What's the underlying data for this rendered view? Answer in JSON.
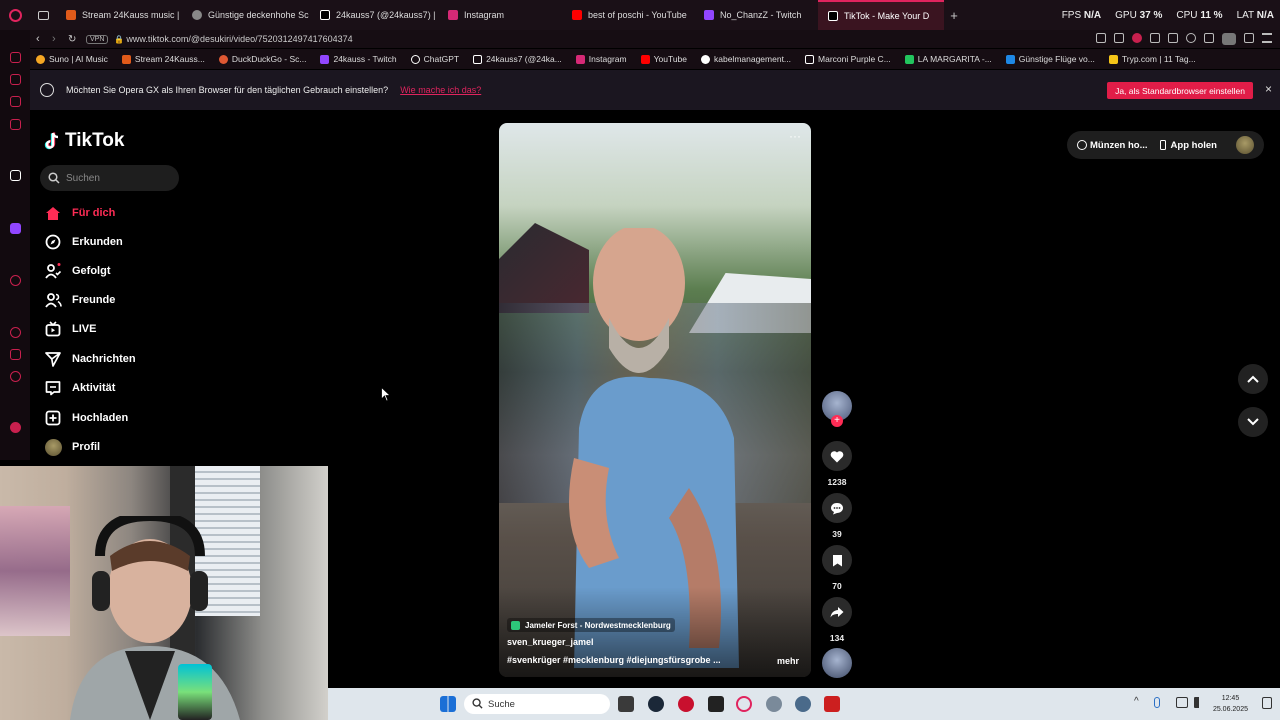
{
  "browser": {
    "tabs": [
      {
        "label": "Stream 24Kauss music |",
        "color": "#e05a1a"
      },
      {
        "label": "Günstige deckenhohe Sc",
        "color": "#888888"
      },
      {
        "label": "24kauss7 (@24kauss7) |",
        "color": "#ffffff"
      },
      {
        "label": "Instagram",
        "color": "#d62976"
      },
      {
        "label": "best of poschi - YouTube",
        "color": "#ff0000"
      },
      {
        "label": "No_ChanzZ - Twitch",
        "color": "#9146ff"
      },
      {
        "label": "TikTok - Make Your D",
        "color": "#ffffff"
      }
    ],
    "stats": {
      "fps_label": "FPS",
      "fps_value": "N/A",
      "gpu_label": "GPU",
      "gpu_value": "37 %",
      "cpu_label": "CPU",
      "cpu_value": "11 %",
      "lat_label": "LAT",
      "lat_value": "N/A"
    },
    "vpn_label": "VPN",
    "url": "www.tiktok.com/@desukiri/video/7520312497417604374",
    "bookmarks": [
      {
        "label": "Suno | AI Music",
        "color": "#f5a623"
      },
      {
        "label": "Stream 24Kauss...",
        "color": "#e05a1a"
      },
      {
        "label": "DuckDuckGo - Sc...",
        "color": "#de5833"
      },
      {
        "label": "24kauss - Twitch",
        "color": "#9146ff"
      },
      {
        "label": "ChatGPT",
        "color": "#ffffff"
      },
      {
        "label": "24kauss7 (@24ka...",
        "color": "#ffffff"
      },
      {
        "label": "Instagram",
        "color": "#d62976"
      },
      {
        "label": "YouTube",
        "color": "#ff0000"
      },
      {
        "label": "kabelmanagement...",
        "color": "#4caf50"
      },
      {
        "label": "Marconi Purple C...",
        "color": "#ffffff"
      },
      {
        "label": "LA MARGARITA -...",
        "color": "#22c55e"
      },
      {
        "label": "Günstige Flüge vo...",
        "color": "#1e88e5"
      },
      {
        "label": "Tryp.com | 11 Tag...",
        "color": "#f5c518"
      }
    ],
    "notice": {
      "text": "Möchten Sie Opera GX als Ihren Browser für den täglichen Gebrauch einstellen?",
      "link": "Wie mache ich das?",
      "button": "Ja, als Standardbrowser einstellen",
      "close": "×"
    }
  },
  "tiktok": {
    "logo": "TikTok",
    "search_placeholder": "Suchen",
    "nav": [
      {
        "label": "Für dich",
        "active": true
      },
      {
        "label": "Erkunden"
      },
      {
        "label": "Gefolgt"
      },
      {
        "label": "Freunde"
      },
      {
        "label": "LIVE"
      },
      {
        "label": "Nachrichten"
      },
      {
        "label": "Aktivität"
      },
      {
        "label": "Hochladen"
      },
      {
        "label": "Profil"
      }
    ],
    "top_right": {
      "coins": "Münzen ho...",
      "app": "App holen"
    },
    "video": {
      "location": "Jameler Forst - Nordwestmecklenburg",
      "author": "sven_krueger_jamel",
      "hashtags": "#svenkrüger #mecklenburg #diejungsfürsgrobe ...",
      "more": "mehr",
      "more_menu": "···"
    },
    "actions": {
      "likes": "1238",
      "comments": "39",
      "saves": "70",
      "shares": "134"
    }
  },
  "taskbar": {
    "search": "Suche",
    "time": "12:45",
    "date": "25.06.2025"
  }
}
